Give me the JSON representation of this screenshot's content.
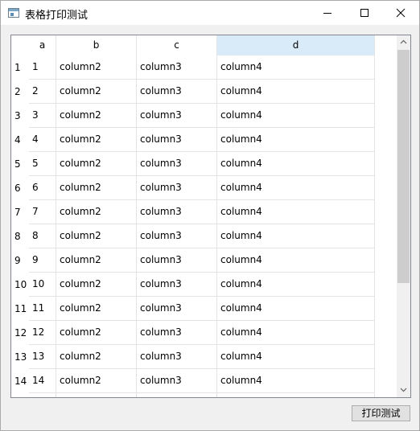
{
  "window": {
    "title": "表格打印测试",
    "icon": "window-app-icon",
    "controls": {
      "minimize_icon": "minimize-icon",
      "maximize_icon": "maximize-icon",
      "close_icon": "close-icon"
    }
  },
  "table": {
    "columns": [
      "a",
      "b",
      "c",
      "d"
    ],
    "selected_column": "d",
    "rows": [
      {
        "header": "1",
        "cells": [
          "1",
          "column2",
          "column3",
          "column4"
        ]
      },
      {
        "header": "2",
        "cells": [
          "2",
          "column2",
          "column3",
          "column4"
        ]
      },
      {
        "header": "3",
        "cells": [
          "3",
          "column2",
          "column3",
          "column4"
        ]
      },
      {
        "header": "4",
        "cells": [
          "4",
          "column2",
          "column3",
          "column4"
        ]
      },
      {
        "header": "5",
        "cells": [
          "5",
          "column2",
          "column3",
          "column4"
        ]
      },
      {
        "header": "6",
        "cells": [
          "6",
          "column2",
          "column3",
          "column4"
        ]
      },
      {
        "header": "7",
        "cells": [
          "7",
          "column2",
          "column3",
          "column4"
        ]
      },
      {
        "header": "8",
        "cells": [
          "8",
          "column2",
          "column3",
          "column4"
        ]
      },
      {
        "header": "9",
        "cells": [
          "9",
          "column2",
          "column3",
          "column4"
        ]
      },
      {
        "header": "10",
        "cells": [
          "10",
          "column2",
          "column3",
          "column4"
        ]
      },
      {
        "header": "11",
        "cells": [
          "11",
          "column2",
          "column3",
          "column4"
        ]
      },
      {
        "header": "12",
        "cells": [
          "12",
          "column2",
          "column3",
          "column4"
        ]
      },
      {
        "header": "13",
        "cells": [
          "13",
          "column2",
          "column3",
          "column4"
        ]
      },
      {
        "header": "14",
        "cells": [
          "14",
          "column2",
          "column3",
          "column4"
        ]
      },
      {
        "header": "",
        "cells": [
          "",
          "",
          "",
          ""
        ]
      }
    ],
    "scrollbar": {
      "up_icon": "chevron-up-icon",
      "down_icon": "chevron-down-icon"
    }
  },
  "footer": {
    "print_button": "打印测试"
  },
  "colors": {
    "selected_header": "#d9ebf9",
    "gridline": "#e3e3e3",
    "window_bg": "#f0f0f0",
    "scroll_thumb": "#cdcdcd"
  }
}
